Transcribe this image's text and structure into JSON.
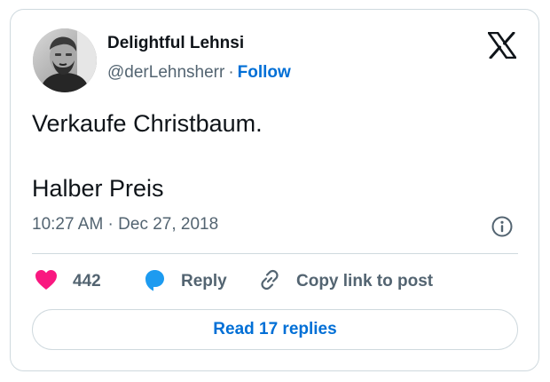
{
  "author": {
    "display_name": "Delightful Lehnsi",
    "handle": "@derLehnsherr",
    "separator": "·",
    "follow_label": "Follow"
  },
  "tweet": {
    "line1": "Verkaufe Christbaum.",
    "line2": "Halber Preis",
    "timestamp": "10:27 AM · Dec 27, 2018"
  },
  "actions": {
    "like_count": "442",
    "reply_label": "Reply",
    "copy_link_label": "Copy link to post"
  },
  "footer": {
    "read_replies_label": "Read 17 replies"
  },
  "icons": {
    "logo": "x-logo-icon",
    "info": "info-icon",
    "like": "heart-icon",
    "reply": "speech-bubble-icon",
    "copy": "link-icon"
  },
  "colors": {
    "link": "#006fd6",
    "like": "#f91880",
    "reply": "#1d9bf0",
    "muted": "#536471",
    "text": "#0f1419",
    "border": "#cfd9de"
  }
}
